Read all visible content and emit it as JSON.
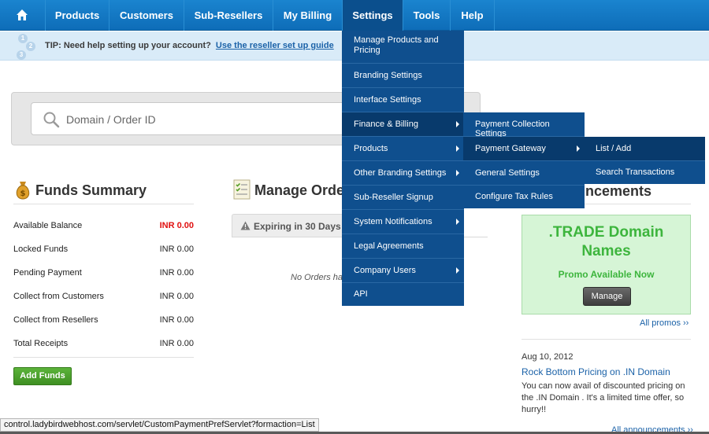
{
  "nav": {
    "home_icon": "home-icon",
    "items": [
      "Products",
      "Customers",
      "Sub-Resellers",
      "My Billing",
      "Settings",
      "Tools",
      "Help"
    ],
    "active": "Settings"
  },
  "tip": {
    "steps": [
      "1",
      "2",
      "3"
    ],
    "text": "TIP: Need help setting up your account?",
    "link": "Use the reseller set up guide"
  },
  "search": {
    "placeholder": "Domain / Order ID",
    "icon": "search-icon"
  },
  "funds": {
    "title": "Funds Summary",
    "rows": [
      {
        "label": "Available Balance",
        "value": "INR 0.00",
        "highlight": true
      },
      {
        "label": "Locked Funds",
        "value": "INR 0.00",
        "highlight": false
      },
      {
        "label": "Pending Payment",
        "value": "INR 0.00",
        "highlight": false
      },
      {
        "label": "Collect from Customers",
        "value": "INR 0.00",
        "highlight": false
      },
      {
        "label": "Collect from Resellers",
        "value": "INR 0.00",
        "highlight": false
      },
      {
        "label": "Total Receipts",
        "value": "INR 0.00",
        "highlight": false
      }
    ],
    "add_button": "Add Funds",
    "highlight_color": "#e01010"
  },
  "orders": {
    "title": "Manage Orders",
    "tab": "Expiring in 30 Days",
    "empty": "No Orders have"
  },
  "settings_menu": {
    "items": [
      {
        "label": "Manage Products and Pricing",
        "submenu": false
      },
      {
        "label": "Branding Settings",
        "submenu": false
      },
      {
        "label": "Interface Settings",
        "submenu": false
      },
      {
        "label": "Finance & Billing",
        "submenu": true,
        "highlighted": true
      },
      {
        "label": "Products",
        "submenu": true
      },
      {
        "label": "Other Branding Settings",
        "submenu": true
      },
      {
        "label": "Sub-Reseller Signup",
        "submenu": false
      },
      {
        "label": "System Notifications",
        "submenu": true
      },
      {
        "label": "Legal Agreements",
        "submenu": false
      },
      {
        "label": "Company Users",
        "submenu": true
      },
      {
        "label": "API",
        "submenu": false
      }
    ]
  },
  "finance_menu": {
    "items": [
      {
        "label": "Payment Collection Settings",
        "submenu": false
      },
      {
        "label": "Payment Gateway",
        "submenu": true,
        "highlighted": true
      },
      {
        "label": "General Settings",
        "submenu": false
      },
      {
        "label": "Configure Tax Rules",
        "submenu": false
      }
    ]
  },
  "gateway_menu": {
    "items": [
      {
        "label": "List / Add",
        "highlighted": true
      },
      {
        "label": "Search Transactions"
      }
    ]
  },
  "announcements": {
    "title": "Announcements",
    "title_visible": "uncements",
    "promo_title": ".TRADE Domain Names",
    "promo_sub": "Promo Available Now",
    "manage_button": "Manage",
    "all_promos": "All promos ››",
    "date": "Aug 10, 2012",
    "headline": "Rock Bottom Pricing on .IN Domain",
    "body": "You can now avail of discounted pricing on the .IN Domain . It's a limited time offer, so hurry!!",
    "all_announcements": "All announcements ››",
    "promo_color": "#3db53d"
  },
  "status_bar": {
    "url": "control.ladybirdwebhost.com/servlet/CustomPaymentPrefServlet?formaction=List"
  }
}
